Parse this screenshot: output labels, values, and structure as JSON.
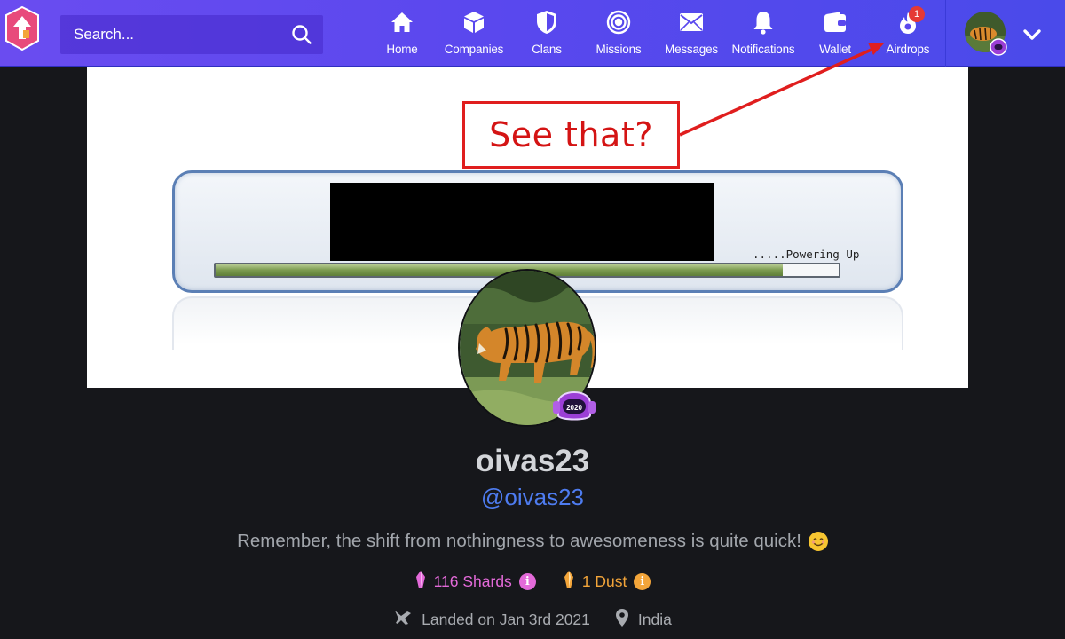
{
  "nav": {
    "search_placeholder": "Search...",
    "items": [
      {
        "label": "Home",
        "icon": "home-icon"
      },
      {
        "label": "Companies",
        "icon": "cube-icon"
      },
      {
        "label": "Clans",
        "icon": "shield-icon"
      },
      {
        "label": "Missions",
        "icon": "target-icon"
      },
      {
        "label": "Messages",
        "icon": "envelope-icon"
      },
      {
        "label": "Notifications",
        "icon": "bell-icon"
      },
      {
        "label": "Wallet",
        "icon": "wallet-icon"
      },
      {
        "label": "Airdrops",
        "icon": "airdrop-icon",
        "badge": "1"
      }
    ],
    "colors": {
      "bar_start": "#6a4cf0",
      "bar_end": "#4a4aea",
      "badge": "#e53935"
    }
  },
  "banner": {
    "callout_text": "See that?",
    "loader_text": ".....Powering Up",
    "progress_fraction": 0.91,
    "callout_color": "#e01e1e"
  },
  "profile": {
    "display_name": "oivas23",
    "handle": "@oivas23",
    "bio": "Remember, the shift from nothingness to awesomeness is quite quick!",
    "helmet_label": "2020",
    "shards": "116 Shards",
    "dust": "1 Dust",
    "landed": "Landed on Jan 3rd 2021",
    "location": "India",
    "colors": {
      "handle": "#4e7cf0",
      "shards": "#e36ad9",
      "dust": "#f3a53a"
    }
  }
}
